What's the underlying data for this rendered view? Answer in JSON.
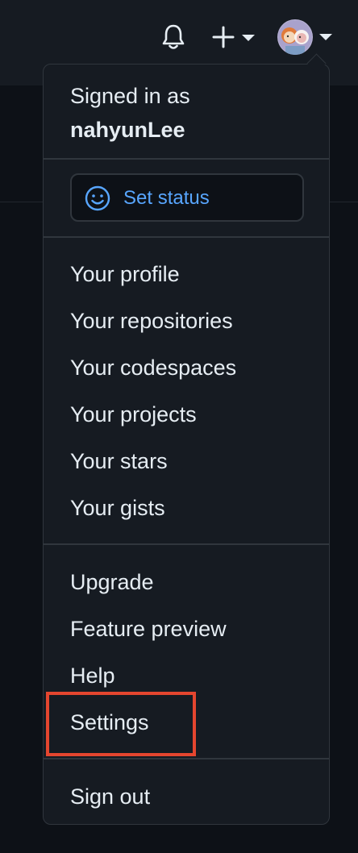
{
  "header": {
    "notifications_icon": "bell-icon",
    "create_icon": "plus-icon",
    "profile_icon": "avatar"
  },
  "menu": {
    "signed_in_label": "Signed in as",
    "username": "nahyunLee",
    "set_status": {
      "label": "Set status",
      "icon": "smiley-icon",
      "color": "#58a6ff"
    },
    "section_profile": [
      {
        "label": "Your profile"
      },
      {
        "label": "Your repositories"
      },
      {
        "label": "Your codespaces"
      },
      {
        "label": "Your projects"
      },
      {
        "label": "Your stars"
      },
      {
        "label": "Your gists"
      }
    ],
    "section_help": [
      {
        "label": "Upgrade"
      },
      {
        "label": "Feature preview"
      },
      {
        "label": "Help"
      },
      {
        "label": "Settings"
      }
    ],
    "sign_out": "Sign out"
  },
  "highlight": {
    "target": "Settings",
    "color": "#e5462f"
  }
}
